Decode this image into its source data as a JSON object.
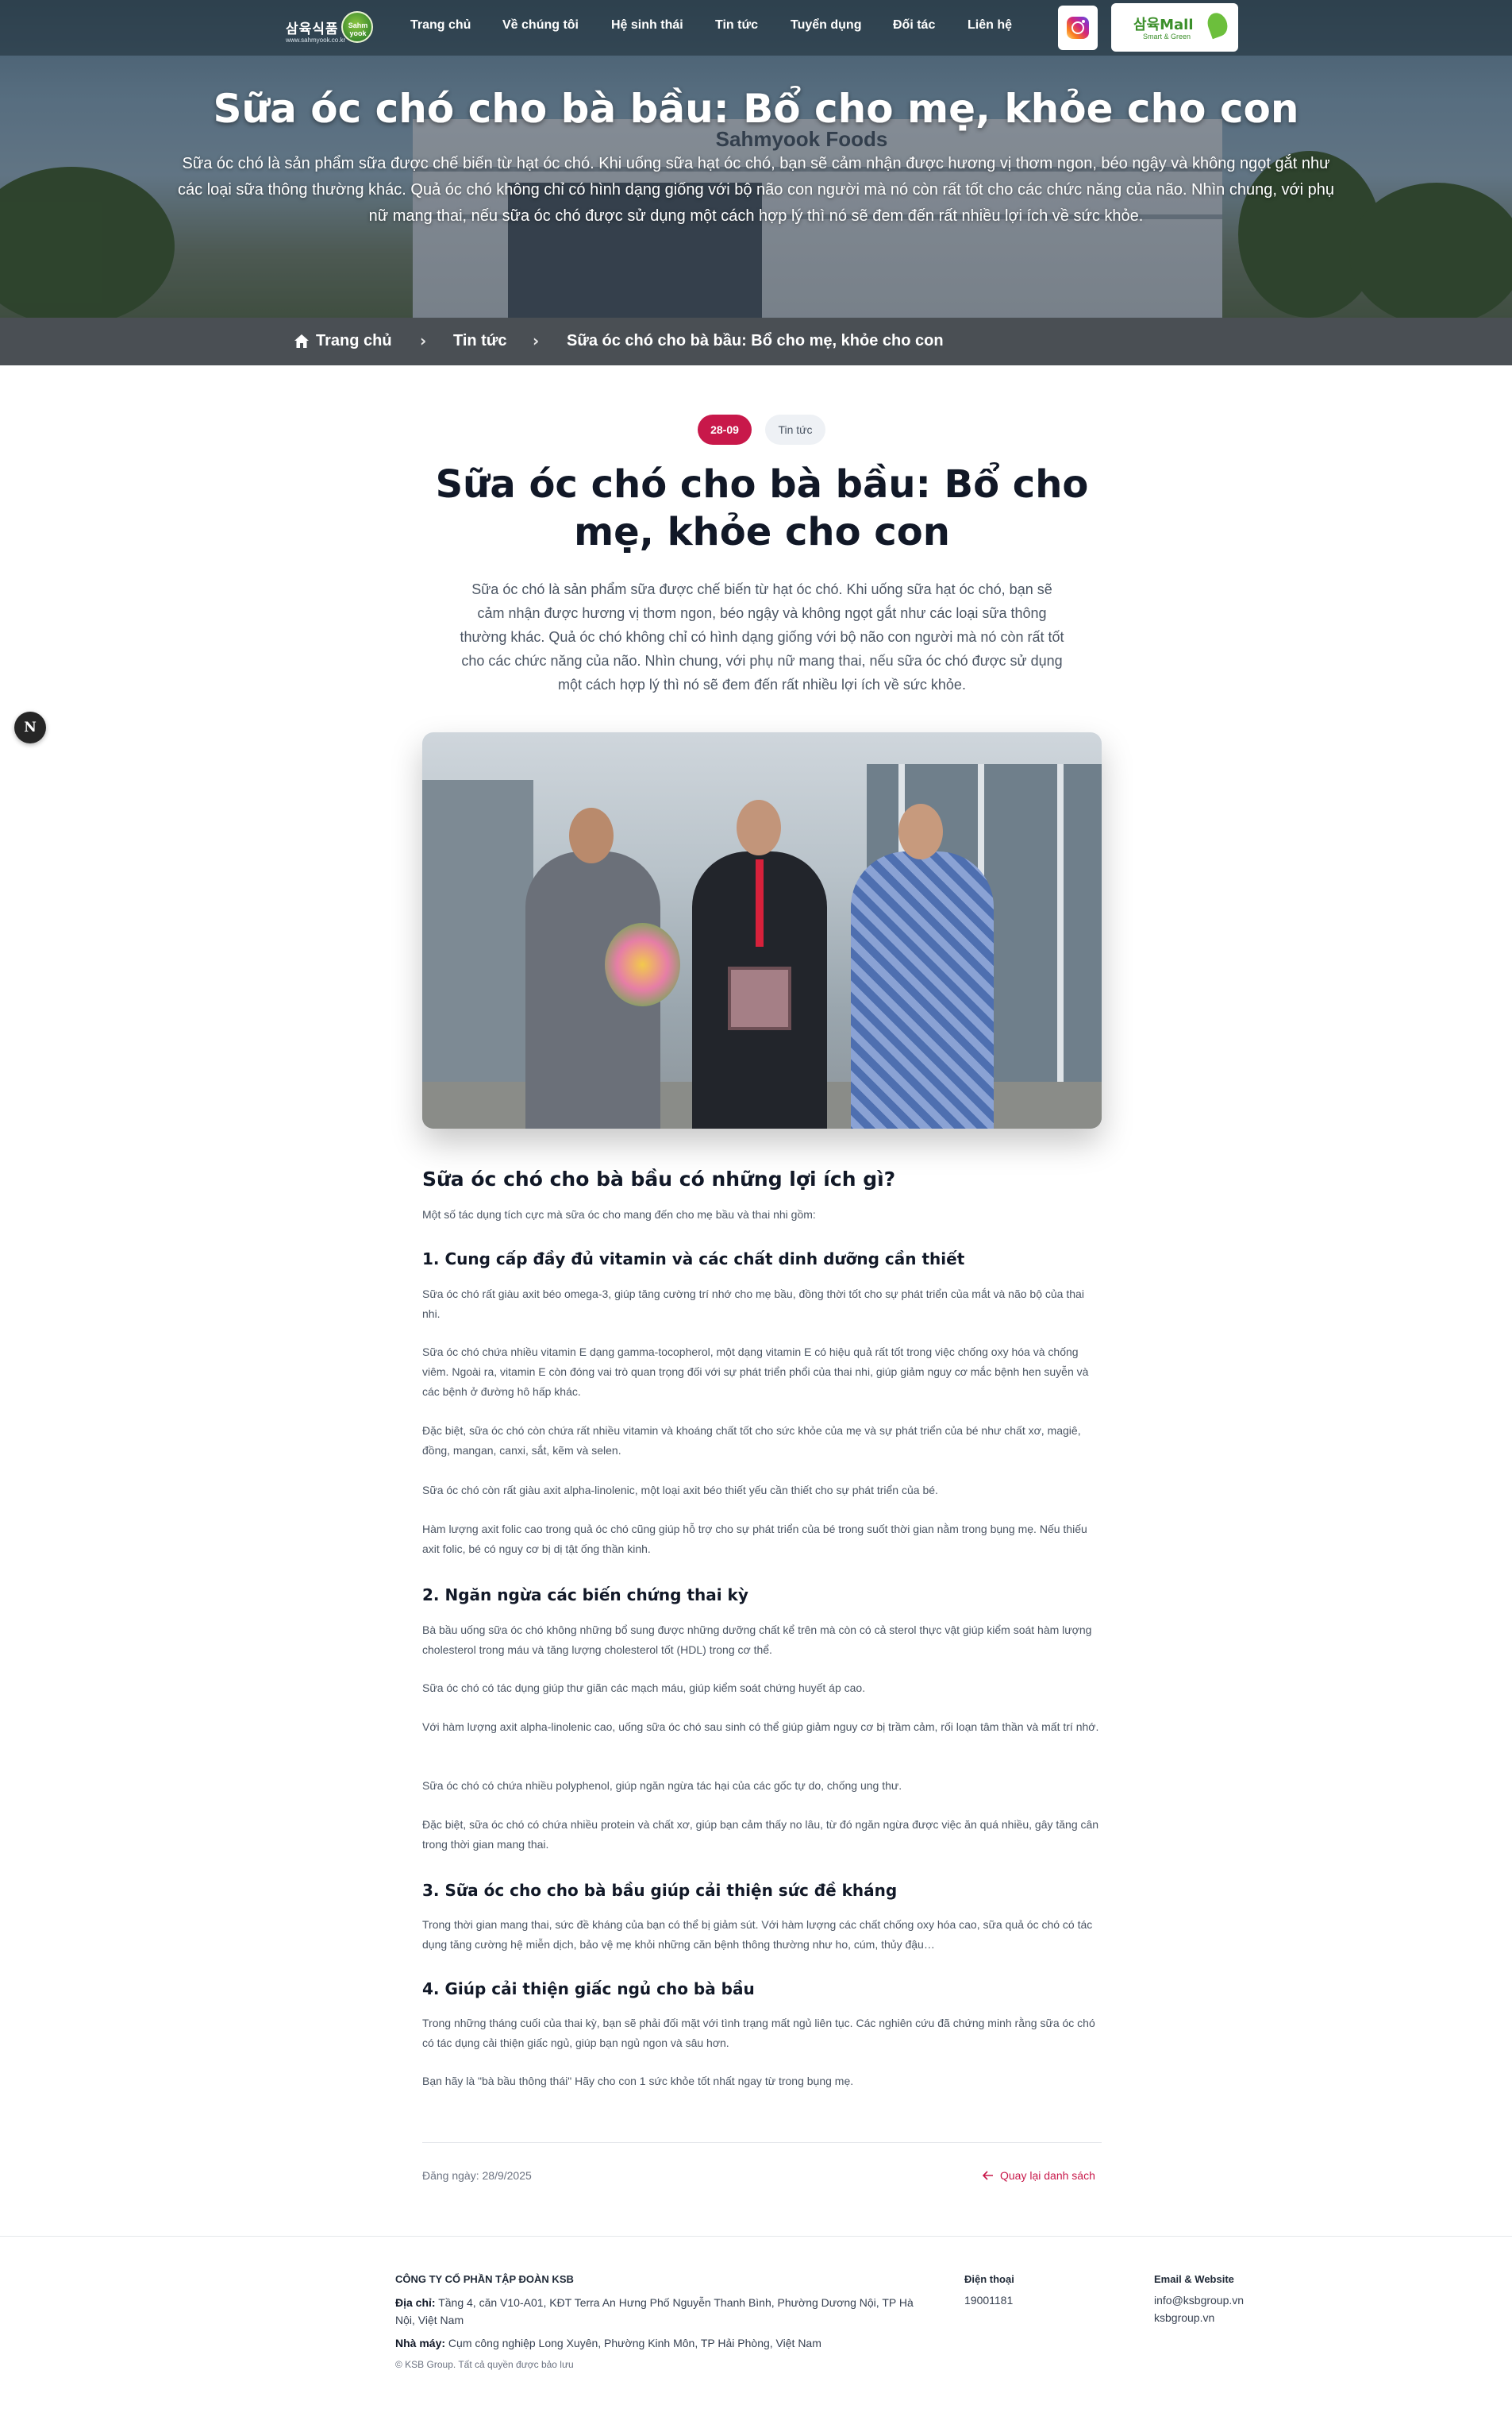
{
  "nav": {
    "logo_text": "삼육식품",
    "logo_sub": "www.sahmyook.co.kr",
    "logo_badge": "Sahm yook",
    "items": [
      "Trang chủ",
      "Về chúng tôi",
      "Hệ sinh thái",
      "Tin tức",
      "Tuyển dụng",
      "Đối tác",
      "Liên hệ"
    ],
    "mall_title": "삼육Mall",
    "mall_sub": "Smart & Green"
  },
  "hero": {
    "sign": "Sahmyook Foods",
    "title": "Sữa óc chó cho bà bầu: Bổ cho mẹ, khỏe cho con",
    "description": "Sữa óc chó là sản phẩm sữa được chế biến từ hạt óc chó. Khi uống sữa hạt óc chó, bạn sẽ cảm nhận được hương vị thơm ngon, béo ngậy và không ngọt gắt như các loại sữa thông thường khác. Quả óc chó không chỉ có hình dạng giống với bộ não con người mà nó còn rất tốt cho các chức năng của não. Nhìn chung, với phụ nữ mang thai, nếu sữa óc chó được sử dụng một cách hợp lý thì nó sẽ đem đến rất nhiều lợi ích về sức khỏe."
  },
  "breadcrumb": {
    "home": "Trang chủ",
    "section": "Tin tức",
    "current": "Sữa óc chó cho bà bầu: Bổ cho mẹ, khỏe cho con",
    "separator": "›"
  },
  "article": {
    "date_tag": "28-09",
    "category_tag": "Tin tức",
    "title": "Sữa óc chó cho bà bầu: Bổ cho mẹ, khỏe cho con",
    "lead": "Sữa óc chó là sản phẩm sữa được chế biến từ hạt óc chó. Khi uống sữa hạt óc chó, bạn sẽ cảm nhận được hương vị thơm ngon, béo ngậy và không ngọt gắt như các loại sữa thông thường khác. Quả óc chó không chỉ có hình dạng giống với bộ não con người mà nó còn rất tốt cho các chức năng của não. Nhìn chung, với phụ nữ mang thai, nếu sữa óc chó được sử dụng một cách hợp lý thì nó sẽ đem đến rất nhiều lợi ích về sức khỏe.",
    "side_button": "N",
    "h2": "Sữa óc chó cho bà bầu có những lợi ích gì?",
    "intro": "Một số tác dụng tích cực mà sữa óc cho mang đến cho mẹ bầu và thai nhi gồm:",
    "s1_title": "1. Cung cấp đầy đủ vitamin và các chất dinh dưỡng cần thiết",
    "s1_p1": "Sữa óc chó rất giàu axit béo omega-3, giúp tăng cường trí nhớ cho mẹ bầu, đồng thời tốt cho sự phát triển của mắt và não bộ của thai nhi.",
    "s1_p2": "Sữa óc chó chứa nhiều vitamin E dạng gamma-tocopherol, một dạng vitamin E có hiệu quả rất tốt trong việc chống oxy hóa và chống viêm. Ngoài ra, vitamin E còn đóng vai trò quan trọng đối với sự phát triển phổi của thai nhi, giúp giảm nguy cơ mắc bệnh hen suyễn và các bệnh ở đường hô hấp khác.",
    "s1_p3": "Đặc biệt, sữa óc chó còn chứa rất nhiều vitamin và khoáng chất tốt cho sức khỏe của mẹ và sự phát triển của bé như chất xơ, magiê, đồng, mangan, canxi, sắt, kẽm và selen.",
    "s1_p4": "Sữa óc chó còn rất giàu axit alpha-linolenic, một loại axit béo thiết yếu cần thiết cho sự phát triển của bé.",
    "s1_p5": "Hàm lượng axit folic cao trong quả óc chó cũng giúp hỗ trợ cho sự phát triển của bé trong suốt thời gian nằm trong bụng mẹ. Nếu thiếu axit folic, bé có nguy cơ bị dị tật ống thần kinh.",
    "s2_title": "2. Ngăn ngừa các biến chứng thai kỳ",
    "s2_p1": "Bà bầu uống sữa óc chó không những bổ sung được những dưỡng chất kể trên mà còn có cả sterol thực vật giúp kiểm soát hàm lượng cholesterol trong máu và tăng lượng cholesterol tốt (HDL) trong cơ thể.",
    "s2_p2": "Sữa óc chó có tác dụng giúp thư giãn các mạch máu, giúp kiểm soát chứng huyết áp cao.",
    "s2_p3": "Với hàm lượng axit alpha-linolenic cao, uống sữa óc chó sau sinh có thể giúp giảm nguy cơ bị trầm cảm, rối loạn tâm thần và mất trí nhớ.",
    "s2_p4": "Sữa óc chó có chứa nhiều polyphenol, giúp ngăn ngừa tác hại của các gốc tự do, chống ung thư.",
    "s2_p5": "Đặc biệt, sữa óc chó có chứa nhiều protein và chất xơ, giúp bạn cảm thấy no lâu, từ đó ngăn ngừa được việc ăn quá nhiều, gây tăng cân trong thời gian mang thai.",
    "s3_title": "3. Sữa óc cho cho bà bầu giúp cải thiện sức đề kháng",
    "s3_p1": "Trong thời gian mang thai, sức đề kháng của bạn có thể bị giảm sút. Với hàm lượng các chất chống oxy hóa cao, sữa quả óc chó có tác dụng tăng cường hệ miễn dịch, bảo vệ mẹ khỏi những căn bệnh thông thường như ho, cúm, thủy đậu…",
    "s4_title": "4. Giúp cải thiện giấc ngủ cho bà bầu",
    "s4_p1": "Trong những tháng cuối của thai kỳ, bạn sẽ phải đối mặt với tình trạng mất ngủ liên tục. Các nghiên cứu đã chứng minh rằng sữa óc chó có tác dụng cải thiện giấc ngủ, giúp bạn ngủ ngon và sâu hơn.",
    "s4_p2": "Bạn hãy là \"bà bầu thông thái\" Hãy cho con 1 sức khỏe tốt nhất ngay từ trong bụng mẹ.",
    "posted": "Đăng ngày: 28/9/2025",
    "back": "Quay lại danh sách"
  },
  "footer": {
    "company": "CÔNG TY CỔ PHẦN TẬP ĐOÀN KSB",
    "address_label": "Địa chỉ:",
    "address": "Tầng 4, căn V10-A01, KĐT Terra An Hưng Phố Nguyễn Thanh Bình, Phường Dương Nội, TP Hà Nội, Việt Nam",
    "factory_label": "Nhà máy:",
    "factory": "Cụm công nghiệp Long Xuyên, Phường Kinh Môn, TP Hải Phòng, Việt Nam",
    "copyright": "© KSB Group. Tất cả quyền được bảo lưu",
    "phone_label": "Điện thoại",
    "phone": "19001181",
    "email_label": "Email & Website",
    "email": "info@ksbgroup.vn",
    "website": "ksbgroup.vn"
  },
  "colors": {
    "accent": "#c8184a",
    "breadcrumb_bg": "#4a4f54",
    "text_dark": "#111827",
    "text_body": "#4b5563"
  },
  "icons": [
    "home-icon",
    "instagram-icon",
    "arrow-left-icon",
    "chevron-right-icon"
  ]
}
